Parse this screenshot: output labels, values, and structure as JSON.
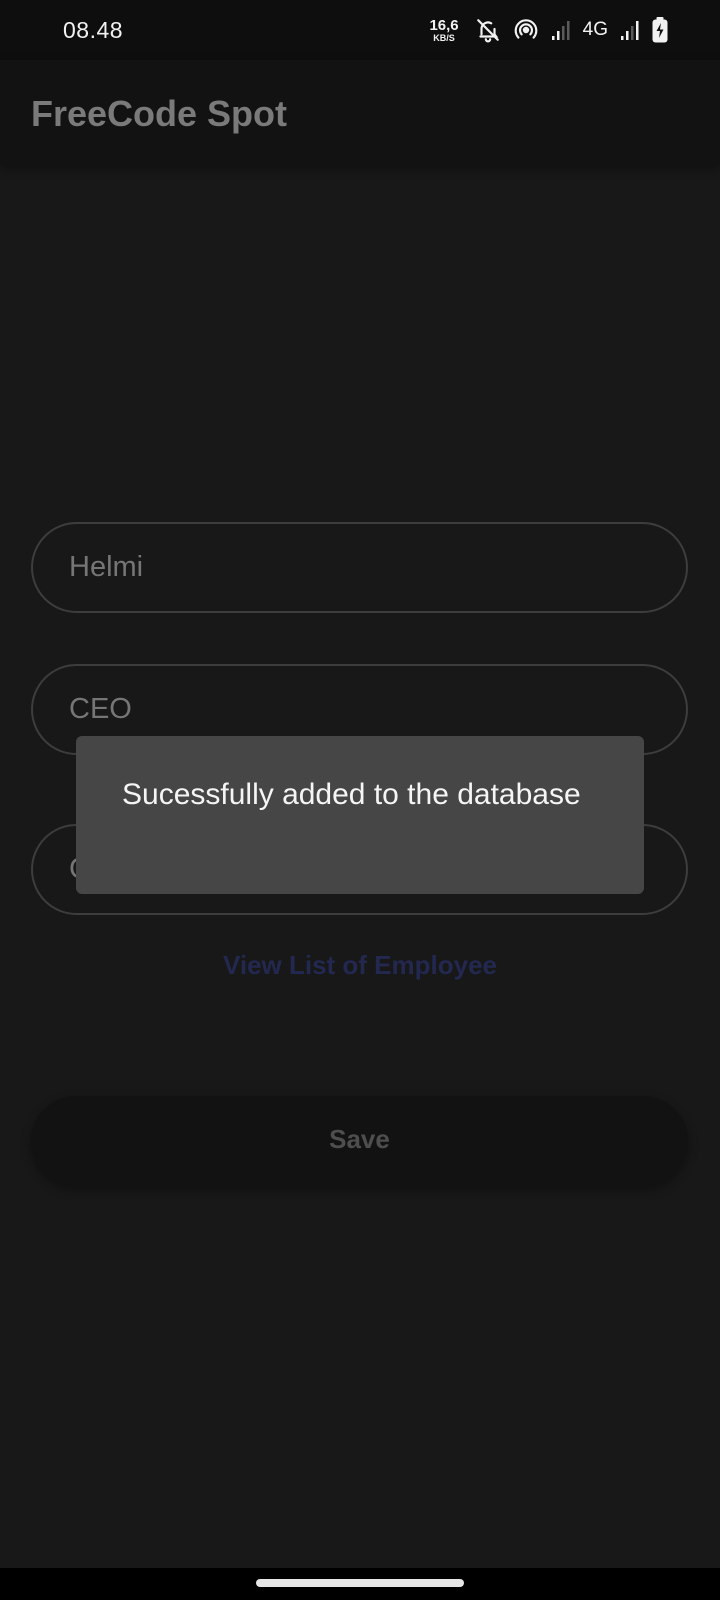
{
  "status_bar": {
    "time": "08.48",
    "net_speed_value": "16,6",
    "net_speed_unit": "KB/S",
    "network_type": "4G",
    "icons": [
      "bell-off-icon",
      "hotspot-icon",
      "signal-icon",
      "signal-icon",
      "battery-charging-icon"
    ]
  },
  "app_bar": {
    "title": "FreeCode Spot"
  },
  "form": {
    "name_value": "Helmi",
    "position_value": "CEO",
    "third_value": "C",
    "view_list_label": "View List of Employee",
    "save_label": "Save"
  },
  "toast": {
    "message": "Sucessfully added to the database"
  },
  "colors": {
    "background": "#181818",
    "app_bar": "#121212",
    "toast_bg": "#464646",
    "link": "#232850"
  }
}
